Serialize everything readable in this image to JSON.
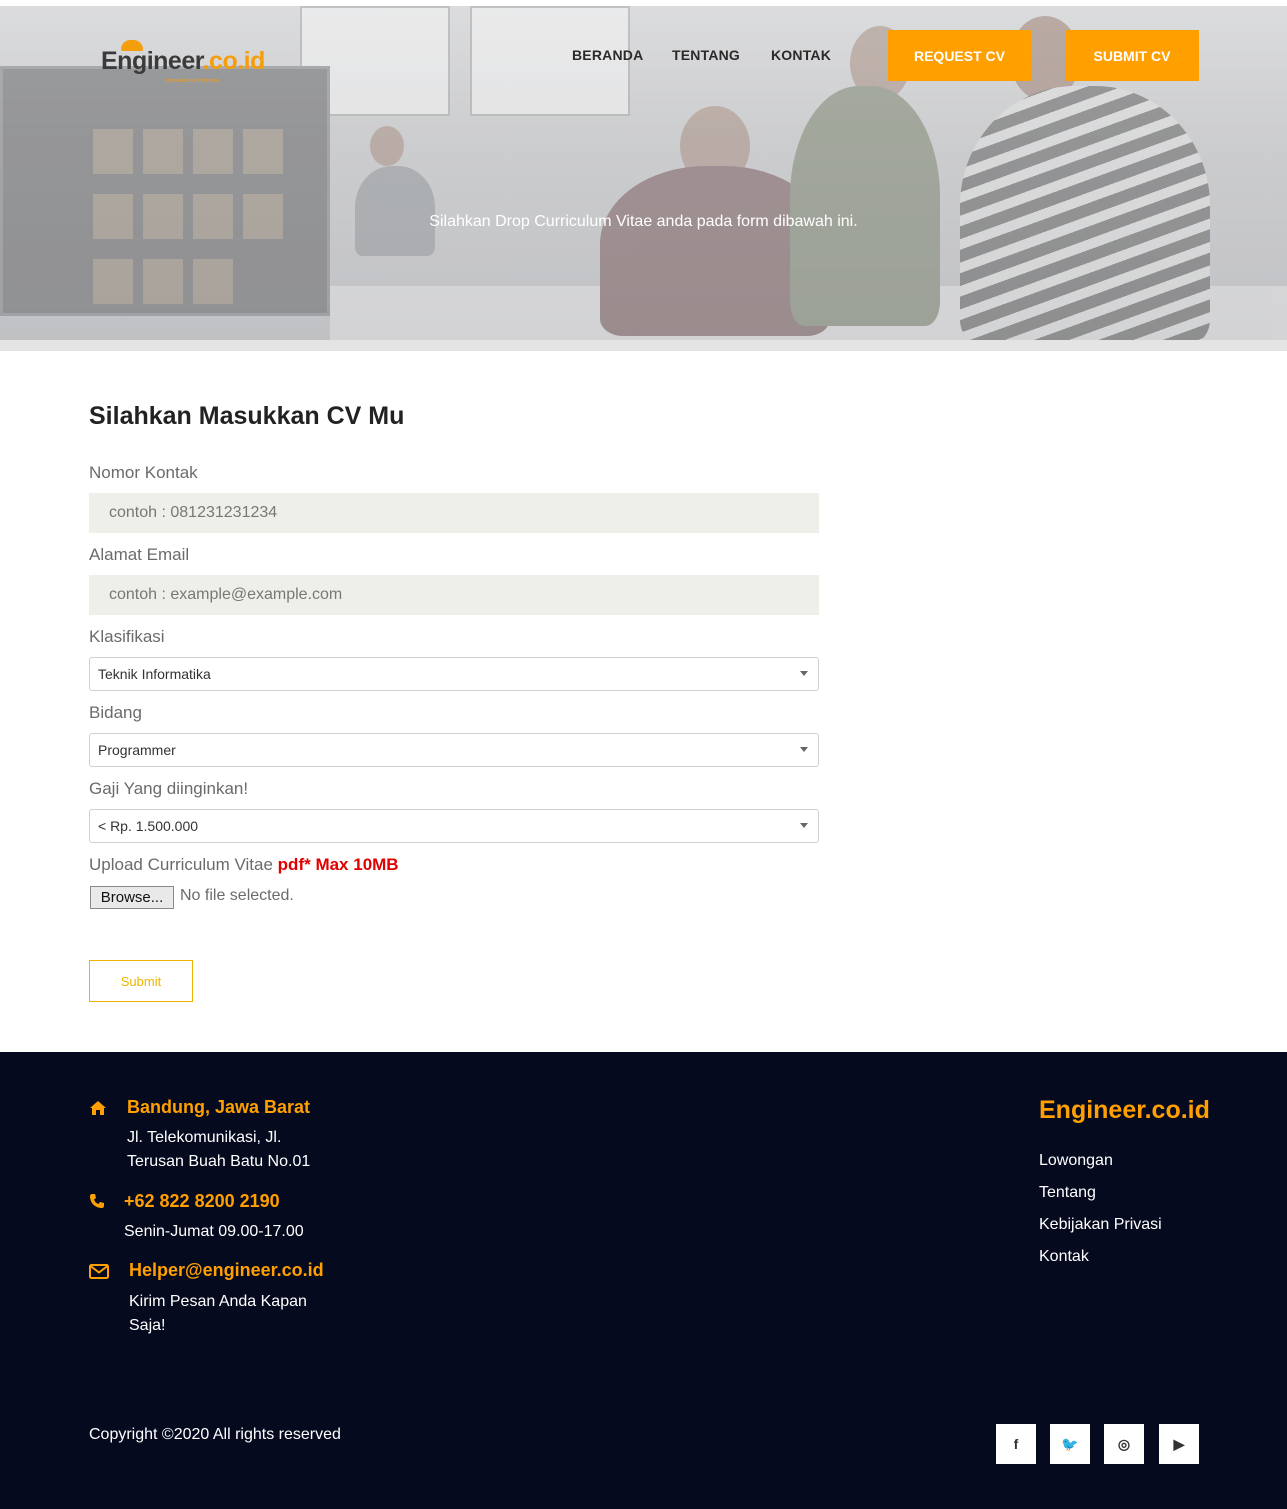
{
  "header": {
    "logo": {
      "main": "Engineer",
      "accent": ".co.id",
      "tagline": "Innovation for Indonesia"
    },
    "nav": [
      "BERANDA",
      "TENTANG",
      "KONTAK"
    ],
    "buttons": {
      "request": "REQUEST CV",
      "submit": "SUBMIT CV"
    },
    "hero_text": "Silahkan Drop Curriculum Vitae anda pada form dibawah ini."
  },
  "form": {
    "title": "Silahkan Masukkan CV Mu",
    "contact": {
      "label": "Nomor Kontak",
      "placeholder": "contoh : 081231231234"
    },
    "email": {
      "label": "Alamat Email",
      "placeholder": "contoh : example@example.com"
    },
    "classification": {
      "label": "Klasifikasi",
      "value": "Teknik Informatika"
    },
    "field": {
      "label": "Bidang",
      "value": "Programmer"
    },
    "salary": {
      "label": "Gaji Yang diinginkan!",
      "value": "< Rp. 1.500.000"
    },
    "upload": {
      "label": "Upload Curriculum Vitae",
      "note": "pdf* Max 10MB",
      "browse": "Browse...",
      "status": "No file selected."
    },
    "submit": "Submit"
  },
  "footer": {
    "address": {
      "title": "Bandung, Jawa Barat",
      "line1": "Jl. Telekomunikasi, Jl.",
      "line2": "Terusan Buah Batu No.01"
    },
    "phone": {
      "number": "+62 822 8200 2190",
      "hours": "Senin-Jumat 09.00-17.00"
    },
    "email": {
      "address": "Helper@engineer.co.id",
      "line1": "Kirim Pesan Anda Kapan",
      "line2": "Saja!"
    },
    "brand": "Engineer.co.id",
    "links": [
      "Lowongan",
      "Tentang",
      "Kebijakan Privasi",
      "Kontak"
    ],
    "copyright": "Copyright ©2020 All rights reserved",
    "social": [
      {
        "icon": "facebook-icon",
        "glyph": "f"
      },
      {
        "icon": "twitter-icon",
        "glyph": "🐦"
      },
      {
        "icon": "instagram-icon",
        "glyph": "◎"
      },
      {
        "icon": "youtube-icon",
        "glyph": "▶"
      }
    ]
  },
  "colors": {
    "accent": "#ff9f00",
    "footer_bg": "#050a1e",
    "input_bg": "#efefea",
    "submit": "#f0b400",
    "warning": "#e10000"
  }
}
